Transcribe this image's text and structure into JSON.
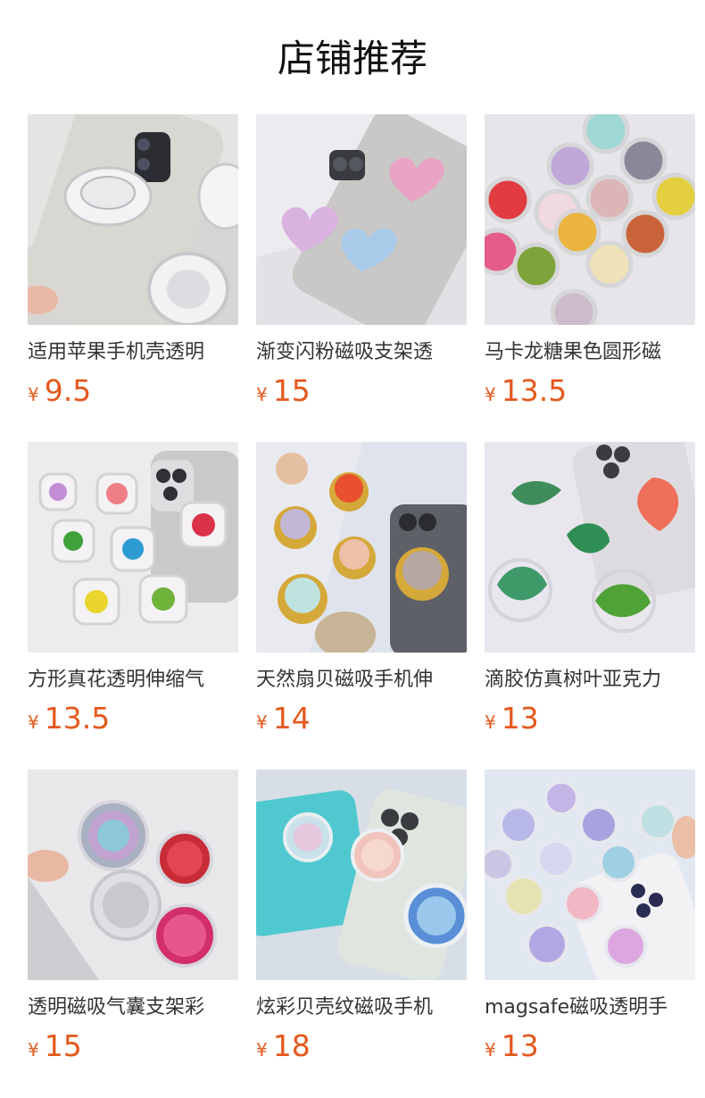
{
  "title": "店铺推荐",
  "products": [
    {
      "name": "适用苹果手机壳透明",
      "currency": "¥",
      "price": "9.5",
      "image": "clear-acrylic-grip"
    },
    {
      "name": "渐变闪粉磁吸支架透",
      "currency": "¥",
      "price": "15",
      "image": "gradient-heart-grip"
    },
    {
      "name": "马卡龙糖果色圆形磁",
      "currency": "¥",
      "price": "13.5",
      "image": "macaron-round-grips"
    },
    {
      "name": "方形真花透明伸缩气",
      "currency": "¥",
      "price": "13.5",
      "image": "pressed-flower-grips"
    },
    {
      "name": "天然扇贝磁吸手机伸",
      "currency": "¥",
      "price": "14",
      "image": "shell-gold-grips"
    },
    {
      "name": "滴胶仿真树叶亚克力",
      "currency": "¥",
      "price": "13",
      "image": "leaf-resin-grips"
    },
    {
      "name": "透明磁吸气囊支架彩",
      "currency": "¥",
      "price": "15",
      "image": "glitter-round-grips"
    },
    {
      "name": "炫彩贝壳纹磁吸手机",
      "currency": "¥",
      "price": "18",
      "image": "iridescent-shell-grips"
    },
    {
      "name": "magsafe磁吸透明手",
      "currency": "¥",
      "price": "13",
      "image": "pastel-resin-grips"
    }
  ],
  "colors": {
    "price": "#e4591d",
    "title": "#111111"
  }
}
